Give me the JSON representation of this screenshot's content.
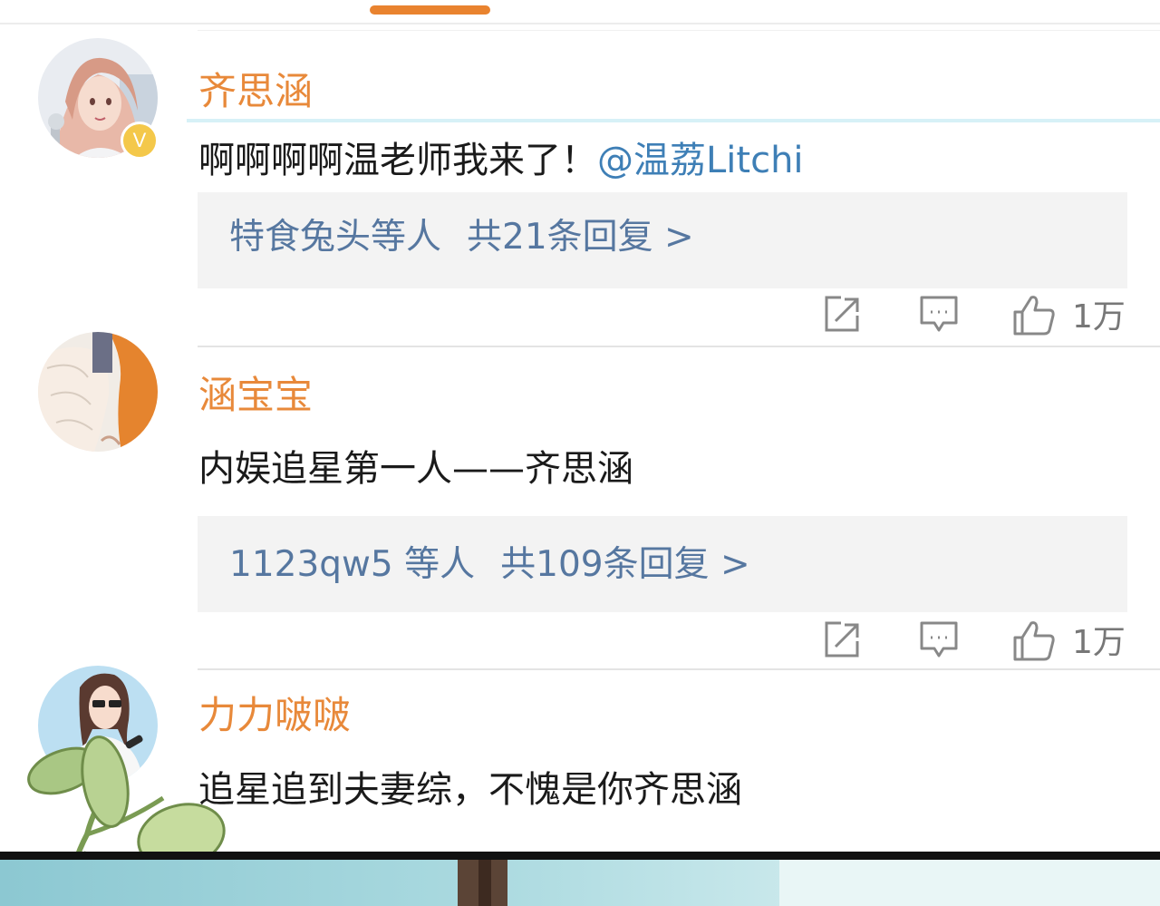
{
  "comments": [
    {
      "username": "齐思涵",
      "verified_badge": "V",
      "text": "啊啊啊啊温老师我来了！",
      "mention": "@温荔Litchi",
      "replies": {
        "from": "特食兔头等人",
        "summary": "共21条回复 >"
      },
      "likes": "1万"
    },
    {
      "username": "涵宝宝",
      "text": "内娱追星第一人——齐思涵",
      "replies": {
        "from": "1123qw5 等人",
        "summary": "共109条回复 >"
      },
      "likes": "1万"
    },
    {
      "username": "力力啵啵",
      "text": "追星追到夫妻综，不愧是你齐思涵"
    }
  ],
  "icons": {
    "share": "share-icon",
    "comment": "comment-icon",
    "like": "thumbs-up-icon"
  },
  "colors": {
    "username": "#e8893a",
    "mention": "#3e7fb6",
    "reply_text": "#5677a0",
    "tab_indicator": "#e9832f"
  }
}
